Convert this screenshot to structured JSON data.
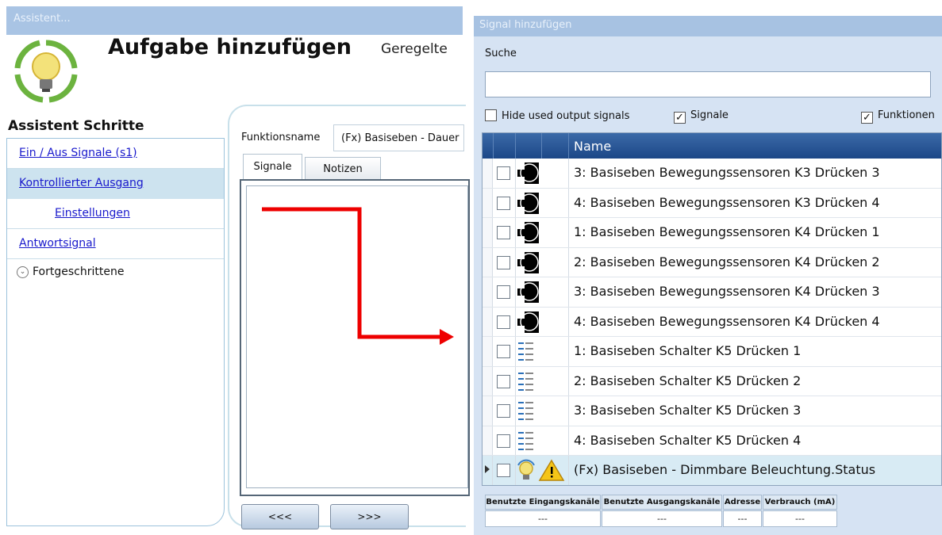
{
  "left": {
    "window_title": "Assistent...",
    "page_title": "Aufgabe hinzufügen",
    "page_subtitle": "Geregelte",
    "steps_heading": "Assistent Schritte",
    "steps": [
      {
        "label": "Ein / Aus Signale (s1)"
      },
      {
        "label": "Kontrollierter Ausgang"
      },
      {
        "label": "Einstellungen"
      },
      {
        "label": "Antwortsignal"
      },
      {
        "label": "Fortgeschrittene"
      }
    ],
    "function_name_label": "Funktionsname",
    "function_name_value": "(Fx) Basiseben - Dauer",
    "tabs": [
      {
        "label": "Signale"
      },
      {
        "label": "Notizen"
      }
    ],
    "back_button": "<<<",
    "next_button": ">>>"
  },
  "right": {
    "window_title": "Signal hinzufügen",
    "search_label": "Suche",
    "search_value": "",
    "checkboxes": [
      {
        "label": "Hide used output signals",
        "checked": false
      },
      {
        "label": "Signale",
        "checked": true
      },
      {
        "label": "Funktionen",
        "checked": true
      }
    ],
    "column_name": "Name",
    "rows": [
      {
        "label": "3: Basiseben Bewegungssensoren K3 Drücken 3",
        "icon": "motion-sensor-icon"
      },
      {
        "label": "4: Basiseben Bewegungssensoren K3 Drücken 4",
        "icon": "motion-sensor-icon"
      },
      {
        "label": "1: Basiseben Bewegungssensoren K4 Drücken 1",
        "icon": "motion-sensor-icon"
      },
      {
        "label": "2: Basiseben Bewegungssensoren K4 Drücken 2",
        "icon": "motion-sensor-icon"
      },
      {
        "label": "3: Basiseben Bewegungssensoren K4 Drücken 3",
        "icon": "motion-sensor-icon"
      },
      {
        "label": "4: Basiseben Bewegungssensoren K4 Drücken 4",
        "icon": "motion-sensor-icon"
      },
      {
        "label": "1: Basiseben Schalter K5 Drücken 1",
        "icon": "switch-module-icon"
      },
      {
        "label": "2: Basiseben Schalter K5 Drücken 2",
        "icon": "switch-module-icon"
      },
      {
        "label": "3: Basiseben Schalter K5 Drücken 3",
        "icon": "switch-module-icon"
      },
      {
        "label": "4: Basiseben Schalter K5 Drücken 4",
        "icon": "switch-module-icon"
      },
      {
        "label": "(Fx) Basiseben - Dimmbare Beleuchtung.Status",
        "icon": "lightbulb-warning-icon"
      }
    ],
    "stats": {
      "headers": [
        "Benutzte Eingangskanäle",
        "Benutzte Ausgangskanäle",
        "Adresse",
        "Verbrauch (mA)"
      ],
      "values": [
        "---",
        "---",
        "---",
        "---"
      ]
    }
  },
  "colors": {
    "title_bar": "#a9c4e4",
    "link": "#1919cc",
    "active_step": "#cde3ef",
    "grid_header": "#1c4787",
    "arrow": "#ee0000"
  }
}
